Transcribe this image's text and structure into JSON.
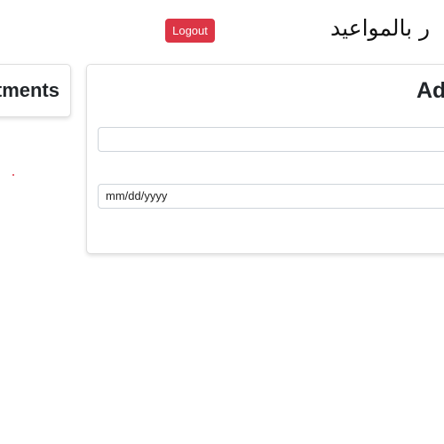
{
  "header": {
    "title": "ر بالمواعيد",
    "logout_label": "Logout"
  },
  "appointments_card": {
    "title": "tments"
  },
  "add_card": {
    "title": "Ad",
    "text_field": {
      "value": "",
      "placeholder": ""
    },
    "date_field": {
      "placeholder": "mm/dd/yyyy"
    }
  },
  "colors": {
    "danger": "#dc3545",
    "card_border": "#dfdfdf",
    "input_border": "#ced4da"
  }
}
